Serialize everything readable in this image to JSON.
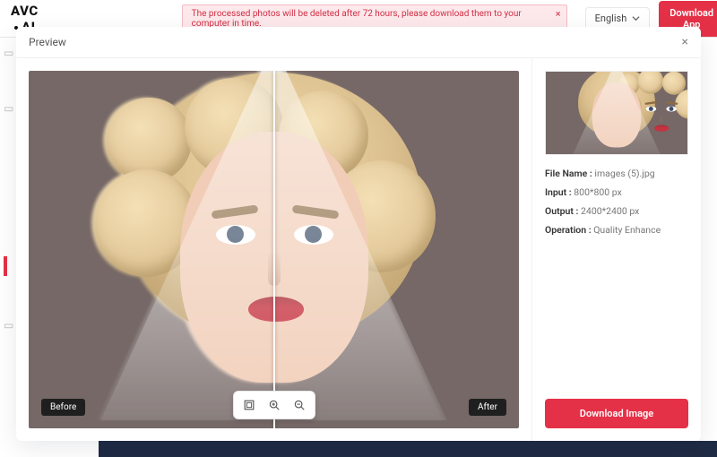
{
  "brand": {
    "part1": "AVC",
    "part2": "AI"
  },
  "banner": {
    "text": "The processed photos will be deleted after 72 hours, please download them to your computer in time."
  },
  "lang_selector": {
    "label": "English"
  },
  "cta_download_app": "Download App",
  "modal": {
    "title": "Preview",
    "before_label": "Before",
    "after_label": "After",
    "download_button": "Download Image"
  },
  "meta": {
    "filename_label": "File Name :",
    "filename_value": "images (5).jpg",
    "input_label": "Input :",
    "input_value": "800*800 px",
    "output_label": "Output :",
    "output_value": "2400*2400 px",
    "operation_label": "Operation :",
    "operation_value": "Quality Enhance"
  }
}
